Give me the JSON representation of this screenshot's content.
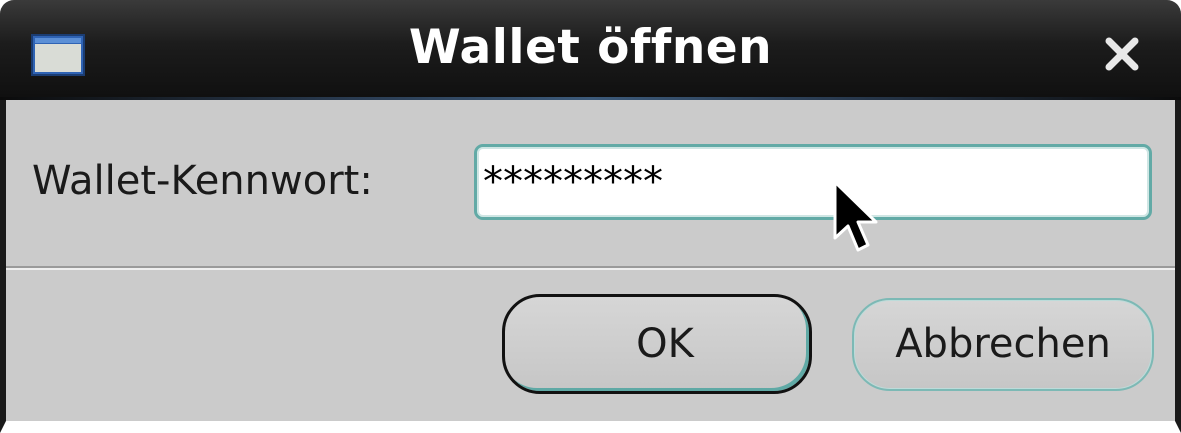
{
  "window": {
    "title": "Wallet öffnen",
    "app_icon": "window-icon",
    "close_icon": "close-icon"
  },
  "form": {
    "password_label": "Wallet-Kennwort:",
    "password_value": "*********"
  },
  "buttons": {
    "ok_label": "OK",
    "cancel_label": "Abbrechen"
  },
  "colors": {
    "titlebar": "#1c1c1c",
    "dialog_bg": "#cbcbcb",
    "focus_accent": "#62aaa6"
  },
  "pointer": "arrow-cursor-icon"
}
